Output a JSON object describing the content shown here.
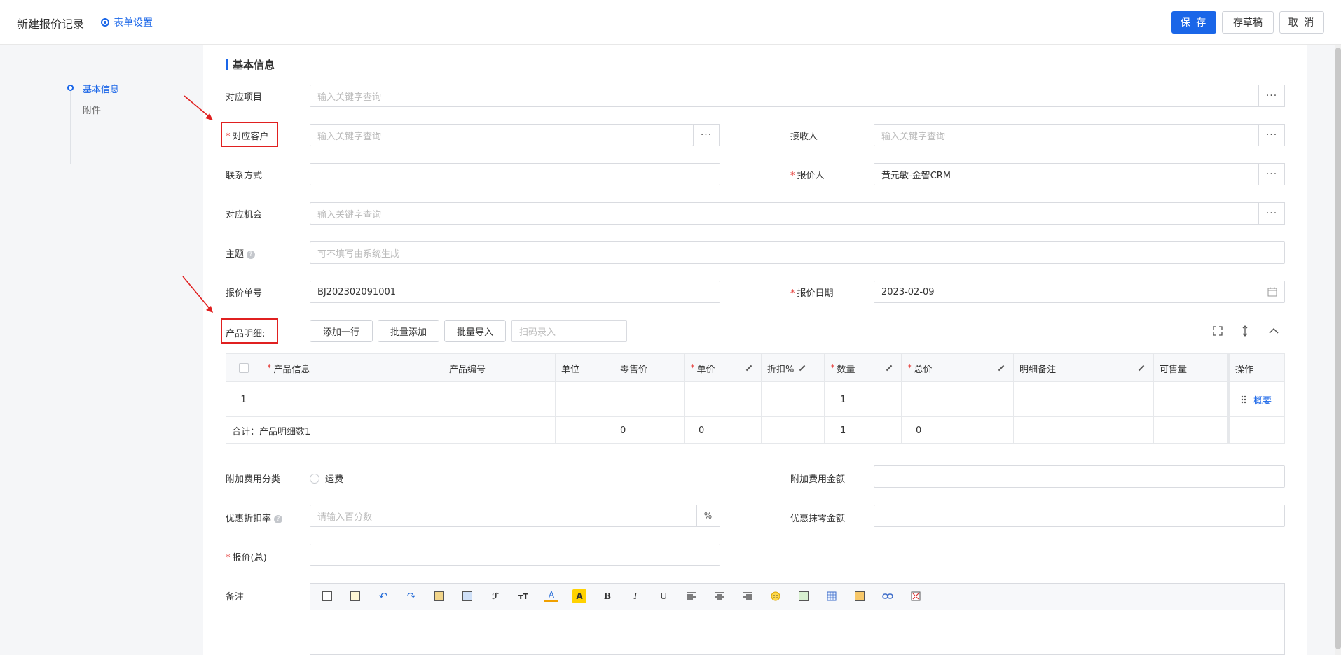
{
  "header": {
    "title": "新建报价记录",
    "form_settings": "表单设置",
    "save": "保 存",
    "draft": "存草稿",
    "cancel": "取 消"
  },
  "nav": {
    "items": [
      {
        "label": "基本信息",
        "active": true
      },
      {
        "label": "附件",
        "active": false
      }
    ]
  },
  "section": {
    "title": "基本信息"
  },
  "fields": {
    "project": {
      "label": "对应项目",
      "placeholder": "输入关键字查询"
    },
    "customer": {
      "label": "对应客户",
      "placeholder": "输入关键字查询"
    },
    "receiver": {
      "label": "接收人",
      "placeholder": "输入关键字查询"
    },
    "contact": {
      "label": "联系方式",
      "value": ""
    },
    "quoter": {
      "label": "报价人",
      "value": "黄元敏-金智CRM"
    },
    "opportunity": {
      "label": "对应机会",
      "placeholder": "输入关键字查询"
    },
    "subject": {
      "label": "主题",
      "placeholder": "可不填写由系统生成"
    },
    "quote_no": {
      "label": "报价单号",
      "value": "BJ202302091001"
    },
    "quote_date": {
      "label": "报价日期",
      "value": "2023-02-09"
    },
    "product_detail": {
      "label": "产品明细:"
    },
    "extra_fee_type": {
      "label": "附加费用分类",
      "option": "运费"
    },
    "extra_fee_amount": {
      "label": "附加费用金额",
      "value": ""
    },
    "discount_rate": {
      "label": "优惠折扣率",
      "placeholder": "请输入百分数",
      "unit": "%"
    },
    "round_off": {
      "label": "优惠抹零金额",
      "value": ""
    },
    "total_quote": {
      "label": "报价(总)",
      "value": ""
    },
    "remark": {
      "label": "备注"
    }
  },
  "product_toolbar": {
    "add_row": "添加一行",
    "batch_add": "批量添加",
    "batch_import": "批量导入",
    "scan_placeholder": "扫码录入"
  },
  "table": {
    "columns": [
      "产品信息",
      "产品编号",
      "单位",
      "零售价",
      "单价",
      "折扣%",
      "数量",
      "总价",
      "明细备注",
      "可售量",
      "操作"
    ],
    "rows": [
      {
        "index": "1",
        "quantity": "1",
        "action": "概要"
      }
    ],
    "summary": {
      "label": "合计：产品明细数1",
      "retail": "0",
      "unit_price": "0",
      "quantity": "1",
      "total": "0"
    }
  },
  "editor_tools": [
    "clipboard-icon",
    "page-icon",
    "undo-icon",
    "redo-icon",
    "paste-icon",
    "paste-text-icon",
    "font-family-icon",
    "font-size-icon",
    "font-color-icon",
    "highlight-icon",
    "bold-icon",
    "italic-icon",
    "underline-icon",
    "align-left-icon",
    "align-center-icon",
    "align-right-icon",
    "emoji-icon",
    "insert-image-icon",
    "table-icon",
    "picture-icon",
    "link-icon",
    "fullscreen-icon"
  ],
  "editor_glyphs": {
    "font_color": "A",
    "highlight": "A",
    "bold": "B",
    "italic": "I",
    "underline": "U",
    "font_size": "тT",
    "font_family": "ℱ"
  }
}
